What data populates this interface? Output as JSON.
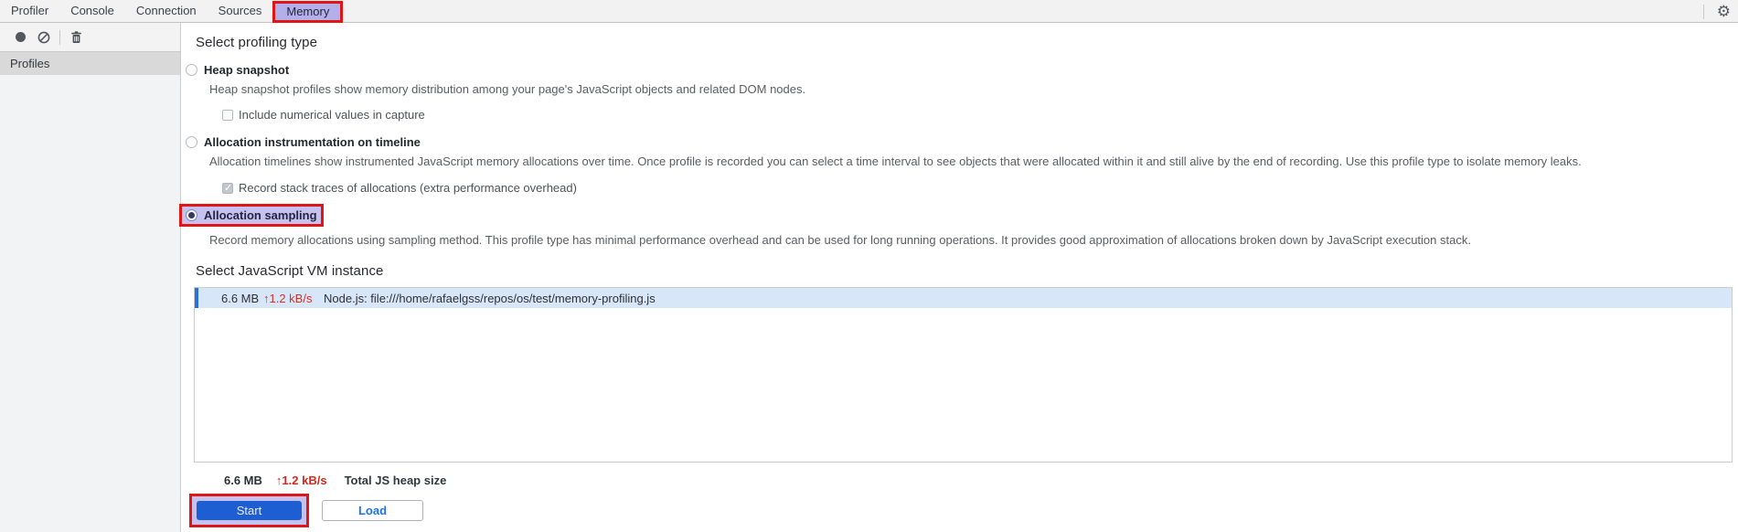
{
  "tabs": {
    "items": [
      {
        "label": "Profiler",
        "active": false
      },
      {
        "label": "Console",
        "active": false
      },
      {
        "label": "Connection",
        "active": false
      },
      {
        "label": "Sources",
        "active": false
      },
      {
        "label": "Memory",
        "active": true,
        "annotated": true
      }
    ]
  },
  "sidebar": {
    "profiles_label": "Profiles",
    "icons": [
      "record-icon",
      "clear-icon",
      "delete-icon"
    ]
  },
  "settings_icon": "⚙",
  "profiling": {
    "heading": "Select profiling type",
    "options": [
      {
        "label": "Heap snapshot",
        "selected": false,
        "description": "Heap snapshot profiles show memory distribution among your page's JavaScript objects and related DOM nodes.",
        "checkbox": {
          "label": "Include numerical values in capture",
          "checked": false
        }
      },
      {
        "label": "Allocation instrumentation on timeline",
        "selected": false,
        "description": "Allocation timelines show instrumented JavaScript memory allocations over time. Once profile is recorded you can select a time interval to see objects that were allocated within it and still alive by the end of recording. Use this profile type to isolate memory leaks.",
        "checkbox": {
          "label": "Record stack traces of allocations (extra performance overhead)",
          "checked": true,
          "disabled": true
        }
      },
      {
        "label": "Allocation sampling",
        "selected": true,
        "annotated": true,
        "description": "Record memory allocations using sampling method. This profile type has minimal performance overhead and can be used for long running operations. It provides good approximation of allocations broken down by JavaScript execution stack."
      }
    ]
  },
  "vm": {
    "heading": "Select JavaScript VM instance",
    "instances": [
      {
        "size": "6.6 MB",
        "rate": "↑1.2 kB/s",
        "name": "Node.js: file:///home/rafaelgss/repos/os/test/memory-profiling.js",
        "selected": true
      }
    ]
  },
  "footer": {
    "size": "6.6 MB",
    "rate": "↑1.2 kB/s",
    "label": "Total JS heap size",
    "start_label": "Start",
    "load_label": "Load"
  },
  "colors": {
    "annotation_red": "#e01515",
    "highlight_purple": "#b3b0e9",
    "selected_row_blue": "#d7e7f9",
    "row_stripe_blue": "#2a6fdb",
    "rate_red": "#d93025",
    "start_button_blue": "#1d5fd3",
    "load_text_blue": "#1a73e8"
  }
}
